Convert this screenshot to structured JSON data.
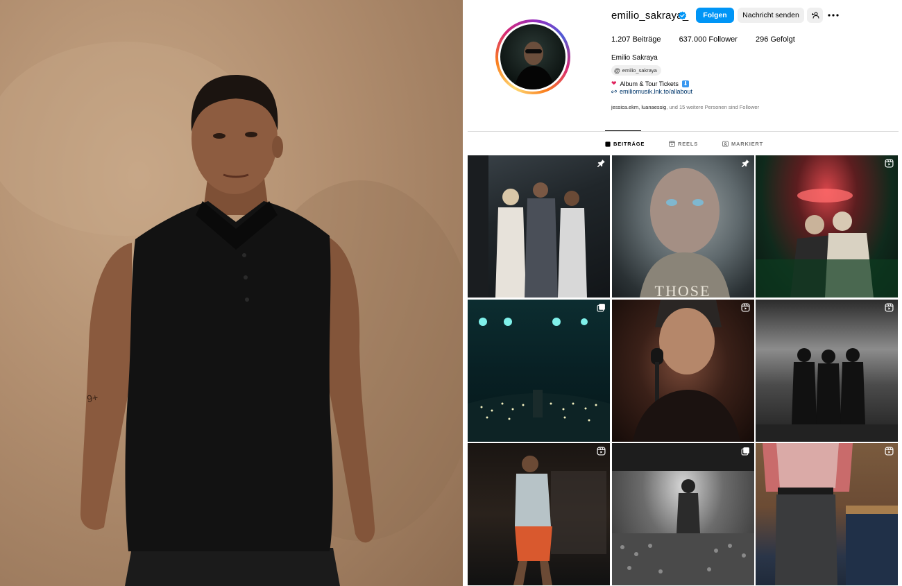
{
  "profile": {
    "username": "emilio_sakraya_",
    "follow_label": "Folgen",
    "message_label": "Nachricht senden",
    "add_user_label": "+",
    "more_label": "•••",
    "stats": {
      "posts": "1.207 Beiträge",
      "followers": "637.000 Follower",
      "following": "296 Gefolgt"
    },
    "full_name": "Emilio Sakraya",
    "threads_handle": "emilio_sakraya",
    "bio_line": "Album & Tour Tickets",
    "link": "emiliomusik.lnk.to/allabout",
    "followed_by": {
      "names": "jessica.ekm, luanaessig",
      "rest": ", und 15 weitere Personen sind Follower"
    }
  },
  "tabs": [
    {
      "label": "BEITRÄGE",
      "icon": "grid-icon",
      "active": true
    },
    {
      "label": "REELS",
      "icon": "reels-icon",
      "active": false
    },
    {
      "label": "MARKIERT",
      "icon": "tagged-icon",
      "active": false
    }
  ],
  "grid_posts": [
    {
      "badge": "pin-icon",
      "overlay_text": ""
    },
    {
      "badge": "pin-icon",
      "overlay_text": "THOSE"
    },
    {
      "badge": "reel-icon",
      "overlay_text": ""
    },
    {
      "badge": "carousel-icon",
      "overlay_text": ""
    },
    {
      "badge": "reel-icon",
      "overlay_text": ""
    },
    {
      "badge": "reel-icon",
      "overlay_text": ""
    },
    {
      "badge": "reel-icon",
      "overlay_text": ""
    },
    {
      "badge": "carousel-icon",
      "overlay_text": ""
    },
    {
      "badge": "reel-icon",
      "overlay_text": ""
    }
  ],
  "colors": {
    "follow_button": "#0095f6",
    "secondary_button": "#efefef",
    "verified": "#0095f6",
    "link": "#00376b"
  }
}
